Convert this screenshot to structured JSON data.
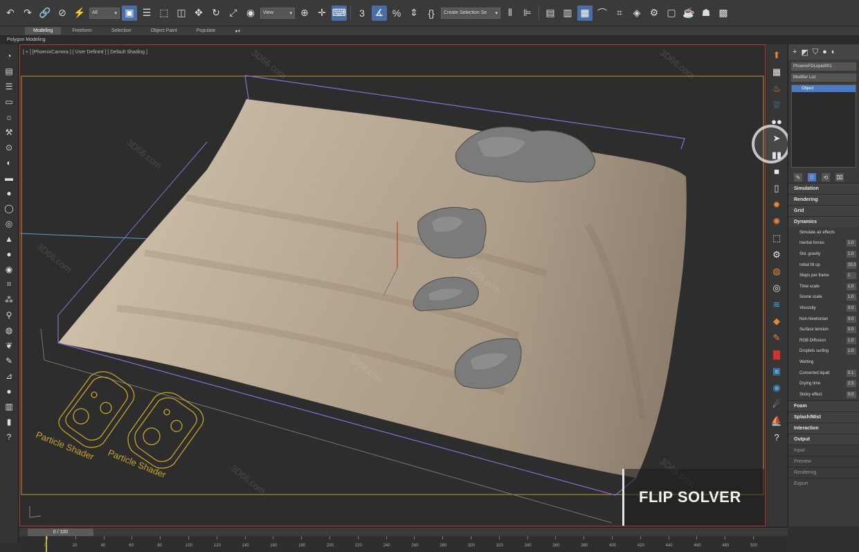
{
  "toolbar": {
    "undo_icon": "undo-icon",
    "redo_icon": "redo-icon",
    "selection_filter": "All",
    "ref_coord": "View",
    "named_selection": "Create Selection Se"
  },
  "ribbon": {
    "tabs": [
      "Modeling",
      "Freeform",
      "Selection",
      "Object Paint",
      "Populate"
    ],
    "active": "Modeling",
    "sub_label": "Polygon Modeling"
  },
  "viewport": {
    "label": "[ + ] [PhoenixCamera ] [ User Defined ] [ Default Shading ]",
    "overlay_title": "FLIP SOLVER",
    "emitter_labels": [
      "Particle Shader",
      "Particle Shader"
    ],
    "watermark": "3D66.com",
    "colors": {
      "terrain": "#c8b9a3",
      "rock": "#7a7a7a",
      "bbox": "#8a6fd0",
      "frame": "#b99b25",
      "border": "#b1353a"
    }
  },
  "command_panel": {
    "object_name": "PhoenixFDLiquid001",
    "modifier_list": "Modifier List",
    "stack_item": "Object",
    "rollouts_top": [
      "Simulation",
      "Rendering",
      "Grid",
      "Dynamics"
    ],
    "params": [
      {
        "label": "Simulate air effects",
        "value": ""
      },
      {
        "label": "Inertial forces",
        "value": "1.0"
      },
      {
        "label": "Std. gravity",
        "value": "1.0"
      },
      {
        "label": "Initial fill up",
        "value": "20.0"
      },
      {
        "label": "Steps per frame",
        "value": "1"
      },
      {
        "label": "Time scale",
        "value": "1.0"
      },
      {
        "label": "Scene scale",
        "value": "1.0"
      },
      {
        "label": "Viscosity",
        "value": "0.0"
      },
      {
        "label": "Non-Newtonian",
        "value": "0.0"
      },
      {
        "label": "Surface tension",
        "value": "0.0"
      },
      {
        "label": "RGB Diffusion",
        "value": "1.0"
      },
      {
        "label": "Droplets surfing",
        "value": "1.0"
      },
      {
        "label": "Wetting",
        "value": ""
      },
      {
        "label": "Converted liquid",
        "value": "0.1"
      },
      {
        "label": "Drying time",
        "value": "2.5"
      },
      {
        "label": "Sticky effect",
        "value": "0.0"
      }
    ],
    "rollouts_bottom": [
      "Foam",
      "Splash/Mist",
      "Interaction",
      "Output"
    ],
    "rollouts_dim": [
      "Input",
      "Preview",
      "Rendering",
      "Export"
    ]
  },
  "timeline": {
    "slider": "0 / 100",
    "ticks": [
      "0",
      "20",
      "40",
      "60",
      "80",
      "100",
      "120",
      "140",
      "160",
      "180",
      "200",
      "220",
      "240",
      "260",
      "280",
      "300",
      "320",
      "340",
      "360",
      "380",
      "400",
      "420",
      "440",
      "460",
      "480",
      "500"
    ]
  }
}
